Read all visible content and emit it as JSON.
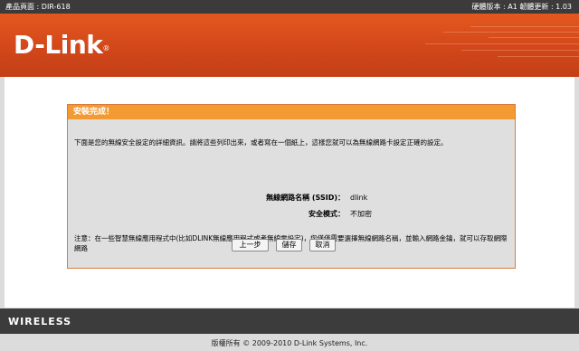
{
  "topbar": {
    "product_page": "產品頁面 : DIR-618",
    "hw_fw": "硬體版本 : A1   韌體更新 : 1.03"
  },
  "brand": {
    "logo_text": "D-Link",
    "logo_mark": "®",
    "brand_color": "#d94e1d"
  },
  "dialog": {
    "title": "安裝完成！",
    "description": "下面是您的無線安全設定的詳細資訊。請將這些列印出來，或者寫在一個紙上，這樣您就可以為無線網路卡設定正確的設定。",
    "ssid_label": "無線網路名稱 (SSID)：",
    "ssid_value": "dlink",
    "security_label": "安全模式：",
    "security_value": "不加密",
    "note": "注意：在一些智慧無線應用程式中(比如DLINK無線應用程式或者無線零設定)，您僅僅需要選擇無線網路名稱，並輸入網路金鑰，就可以存取網際網路",
    "header_color": "#f39a32"
  },
  "buttons": {
    "prev": "上一步",
    "save": "儲存",
    "cancel": "取消"
  },
  "footer": {
    "wireless": "WIRELESS",
    "copyright": "版權所有 © 2009-2010 D-Link Systems, Inc."
  }
}
